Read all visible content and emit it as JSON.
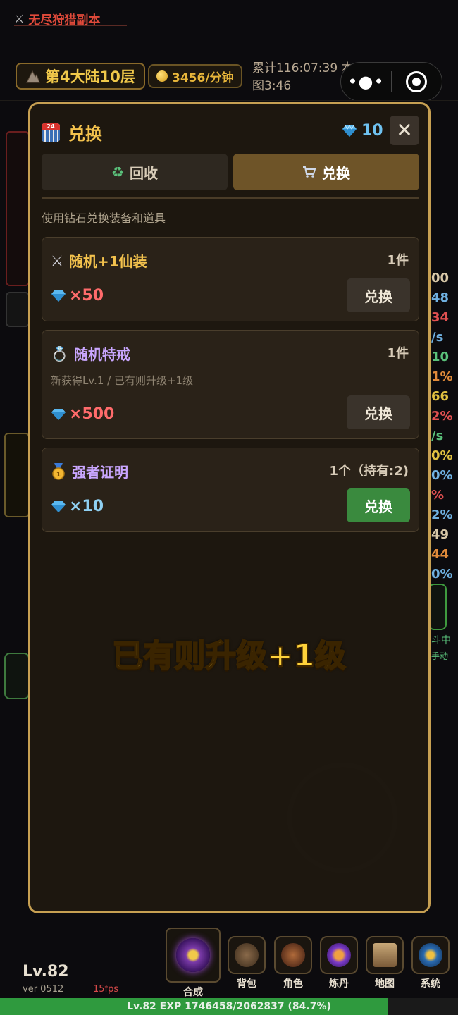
{
  "header": {
    "dungeon_title": "无尽狩猎副本",
    "location": "第4大陆10层",
    "gold_rate": "3456/分钟",
    "stats_line1": "累计116:07:39 本",
    "stats_line2": "图3:46"
  },
  "modal": {
    "title": "兑换",
    "gem_count": "10",
    "close_label": "✕",
    "tabs": [
      {
        "label": "回收",
        "icon": "recycle-icon",
        "active": false
      },
      {
        "label": "兑换",
        "icon": "cart-icon",
        "active": true
      }
    ],
    "subtitle": "使用钻石兑换装备和道具",
    "items": [
      {
        "name": "随机+1仙装",
        "icon": "swords-icon",
        "qty": "1件",
        "price": "×50",
        "affordable": false,
        "button": "兑换",
        "name_color": "#f3c24d"
      },
      {
        "name": "随机特戒",
        "icon": "ring-icon",
        "qty": "1件",
        "desc": "新获得Lv.1 / 已有则升级+1级",
        "price": "×500",
        "affordable": false,
        "button": "兑换",
        "name_color": "#c9a6ff"
      },
      {
        "name": "强者证明",
        "icon": "medal-icon",
        "qty": "1个（持有:2)",
        "price": "×10",
        "affordable": true,
        "button": "兑换",
        "name_color": "#c9a6ff"
      }
    ]
  },
  "toast": "已有则升级+1级",
  "bottom": {
    "level": "Lv.82",
    "version": "ver 0512",
    "fps": "15fps",
    "synth_label": "合成",
    "nav": [
      {
        "label": "背包",
        "icon": "backpack-icon"
      },
      {
        "label": "角色",
        "icon": "character-icon"
      },
      {
        "label": "炼丹",
        "icon": "alchemy-icon"
      },
      {
        "label": "地图",
        "icon": "map-icon"
      },
      {
        "label": "系统",
        "icon": "settings-icon"
      }
    ],
    "exp_text": "Lv.82  EXP 1746458/2062837 (84.7%)",
    "exp_progress": 0.847
  },
  "background": {
    "right_numbers": [
      "00",
      "48",
      "34",
      "/s",
      "10",
      "1%",
      "66",
      "2%",
      "/s",
      "0%",
      "0%",
      "%",
      "2%",
      "49",
      "44",
      "0%"
    ],
    "right_labels": [
      "斗中",
      "手动"
    ],
    "colors": {
      "accent_gold": "#f3c24d",
      "gem_blue": "#6fc2f0",
      "price_red": "#ff6b6b",
      "buy_green": "#3a8a3e",
      "exp_green": "#2f9a3e"
    }
  }
}
